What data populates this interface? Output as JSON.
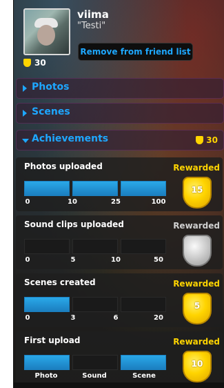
{
  "profile": {
    "username": "viima",
    "status": "\"Testi\"",
    "points": "30",
    "remove_button": "Remove from friend list"
  },
  "sections": {
    "photos": "Photos",
    "scenes": "Scenes",
    "achievements": "Achievements",
    "achievements_points": "30"
  },
  "achievements": [
    {
      "title": "Photos uploaded",
      "status": "Rewarded",
      "state": "gold",
      "badge_value": "15",
      "progress_segments_filled": 3,
      "ticks": [
        "0",
        "10",
        "25",
        "100"
      ]
    },
    {
      "title": "Sound clips uploaded",
      "status": "Rewarded",
      "state": "silver",
      "badge_value": "",
      "progress_segments_filled": 0,
      "ticks": [
        "0",
        "5",
        "10",
        "50"
      ]
    },
    {
      "title": "Scenes created",
      "status": "Rewarded",
      "state": "gold",
      "badge_value": "5",
      "progress_segments_filled": 1,
      "ticks": [
        "0",
        "3",
        "6",
        "20"
      ]
    },
    {
      "title": "First upload",
      "status": "Rewarded",
      "state": "gold",
      "badge_value": "10",
      "progress_segments_filled_pattern": [
        1,
        0,
        1
      ],
      "ticks": [
        "Photo",
        "Sound",
        "Scene"
      ]
    }
  ],
  "colors": {
    "accent_blue": "#1ea7ff",
    "gold": "#ffd400",
    "bar_fill": "#2aa8e8"
  },
  "icons": {
    "shield": "shield-icon",
    "chevron_right": "chevron-right-icon",
    "chevron_down": "chevron-down-icon"
  }
}
